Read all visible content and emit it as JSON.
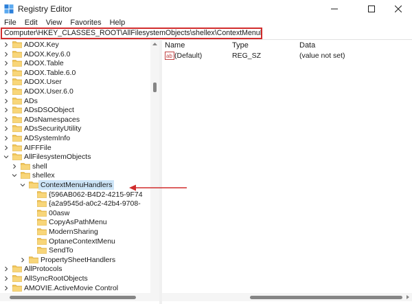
{
  "window": {
    "title": "Registry Editor",
    "icon": "registry-editor-icon"
  },
  "menu": [
    "File",
    "Edit",
    "View",
    "Favorites",
    "Help"
  ],
  "address": "Computer\\HKEY_CLASSES_ROOT\\AllFilesystemObjects\\shellex\\ContextMenuHandlers",
  "tree": {
    "items": [
      {
        "label": "ADOX.Key",
        "level": 1,
        "expander": "collapsed",
        "selected": false
      },
      {
        "label": "ADOX.Key.6.0",
        "level": 1,
        "expander": "collapsed",
        "selected": false
      },
      {
        "label": "ADOX.Table",
        "level": 1,
        "expander": "collapsed",
        "selected": false
      },
      {
        "label": "ADOX.Table.6.0",
        "level": 1,
        "expander": "collapsed",
        "selected": false
      },
      {
        "label": "ADOX.User",
        "level": 1,
        "expander": "collapsed",
        "selected": false
      },
      {
        "label": "ADOX.User.6.0",
        "level": 1,
        "expander": "collapsed",
        "selected": false
      },
      {
        "label": "ADs",
        "level": 1,
        "expander": "collapsed",
        "selected": false
      },
      {
        "label": "ADsDSOObject",
        "level": 1,
        "expander": "collapsed",
        "selected": false
      },
      {
        "label": "ADsNamespaces",
        "level": 1,
        "expander": "collapsed",
        "selected": false
      },
      {
        "label": "ADsSecurityUtility",
        "level": 1,
        "expander": "collapsed",
        "selected": false
      },
      {
        "label": "ADSystemInfo",
        "level": 1,
        "expander": "collapsed",
        "selected": false
      },
      {
        "label": "AIFFFile",
        "level": 1,
        "expander": "collapsed",
        "selected": false
      },
      {
        "label": "AllFilesystemObjects",
        "level": 1,
        "expander": "expanded",
        "selected": false
      },
      {
        "label": "shell",
        "level": 2,
        "expander": "collapsed",
        "selected": false
      },
      {
        "label": "shellex",
        "level": 2,
        "expander": "expanded",
        "selected": false
      },
      {
        "label": "ContextMenuHandlers",
        "level": 3,
        "expander": "expanded",
        "selected": true
      },
      {
        "label": "{596AB062-B4D2-4215-9F74",
        "level": 4,
        "expander": "none",
        "selected": false
      },
      {
        "label": "{a2a9545d-a0c2-42b4-9708-",
        "level": 4,
        "expander": "none",
        "selected": false
      },
      {
        "label": "00asw",
        "level": 4,
        "expander": "none",
        "selected": false
      },
      {
        "label": "CopyAsPathMenu",
        "level": 4,
        "expander": "none",
        "selected": false
      },
      {
        "label": "ModernSharing",
        "level": 4,
        "expander": "none",
        "selected": false
      },
      {
        "label": "OptaneContextMenu",
        "level": 4,
        "expander": "none",
        "selected": false
      },
      {
        "label": "SendTo",
        "level": 4,
        "expander": "none",
        "selected": false
      },
      {
        "label": "PropertySheetHandlers",
        "level": 3,
        "expander": "collapsed",
        "selected": false
      },
      {
        "label": "AllProtocols",
        "level": 1,
        "expander": "collapsed",
        "selected": false
      },
      {
        "label": "AllSyncRootObjects",
        "level": 1,
        "expander": "collapsed",
        "selected": false
      },
      {
        "label": "AMOVIE.ActiveMovie Control",
        "level": 1,
        "expander": "collapsed",
        "selected": false
      }
    ]
  },
  "list": {
    "columns": [
      "Name",
      "Type",
      "Data"
    ],
    "rows": [
      {
        "name": "(Default)",
        "type": "REG_SZ",
        "data": "(value not set)",
        "icon": "string-value-icon"
      }
    ]
  },
  "colors": {
    "annotation": "#d12c2c",
    "folder": "#f2c75c",
    "selection": "#cce4f7"
  }
}
